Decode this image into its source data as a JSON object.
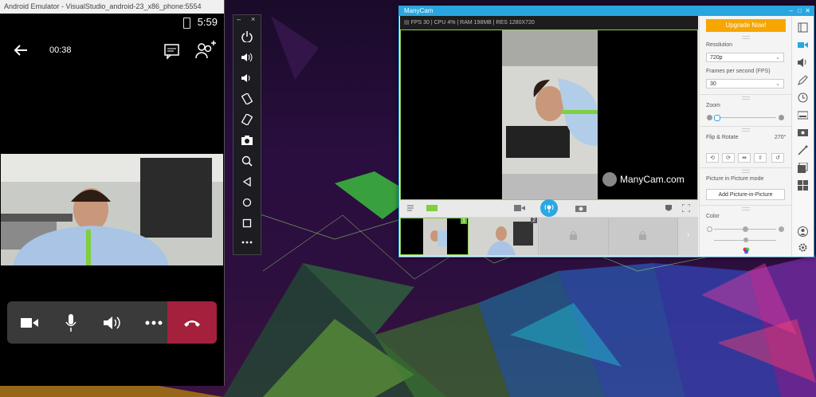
{
  "emulator": {
    "title": "Android Emulator - VisualStudio_android-23_x86_phone:5554",
    "clock": "5:59",
    "call_timer": "00:38",
    "controls": [
      "camera-icon",
      "microphone-icon",
      "speaker-icon",
      "more-icon",
      "end-call-icon"
    ],
    "toolbar": {
      "window_controls": [
        "–",
        "×"
      ],
      "icons": [
        "power-icon",
        "volume-up-icon",
        "volume-down-icon",
        "rotate-left-icon",
        "rotate-right-icon",
        "screenshot-icon",
        "zoom-icon",
        "back-icon",
        "home-icon",
        "overview-icon",
        "more-icon"
      ]
    }
  },
  "manycam": {
    "title": "ManyCam",
    "stats": "FPS 30 | CPU 4% | RAM 198MB | RES 1280X720",
    "watermark": "ManyCam.com",
    "upgrade_label": "Upgrade Now!",
    "resolution_label": "Resolution",
    "resolution_value": "720p",
    "fps_label": "Frames per second (FPS)",
    "fps_value": "30",
    "zoom_label": "Zoom",
    "flip_label": "Flip & Rotate",
    "rotation_value": "270°",
    "pip_label": "Picture in Picture mode",
    "pip_button": "Add Picture-in-Picture",
    "color_label": "Color",
    "thumbs": [
      {
        "num": "1"
      },
      {
        "num": "2"
      }
    ],
    "accent": "#28a6e0",
    "upgrade_color": "#f7a600"
  }
}
